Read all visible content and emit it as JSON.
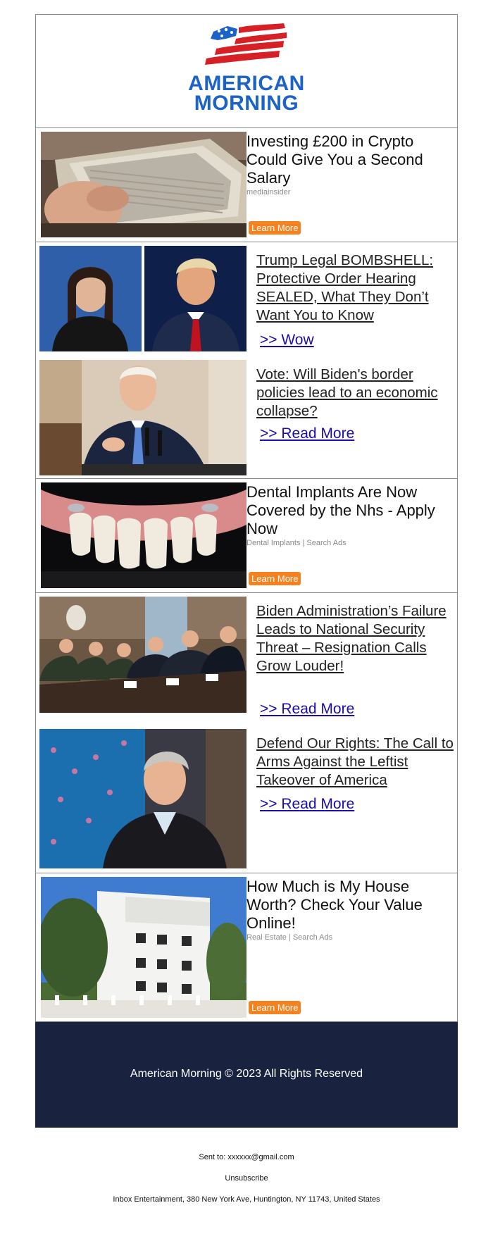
{
  "brand": {
    "name_line1": "AMERICAN",
    "name_line2": "MORNING"
  },
  "ads": [
    {
      "title": "Investing £200 in Crypto Could Give You a Second Salary",
      "source": "mediainsider",
      "cta": "Learn More",
      "image": "banknotes-in-hand-photo"
    },
    {
      "title": "Dental Implants Are Now Covered by the Nhs - Apply Now",
      "source": "Dental Implants | Search Ads",
      "cta": "Learn More",
      "image": "dental-implant-teeth-photo"
    },
    {
      "title": "How Much is My House Worth? Check Your Value Online!",
      "source": "Real Estate | Search Ads",
      "cta": "Learn More",
      "image": "white-house-building-photo"
    }
  ],
  "stories": [
    {
      "headline": "Trump Legal BOMBSHELL: Protective Order Hearing SEALED, What They Don’t Want You to Know",
      "link": ">> Wow",
      "image": "judge-and-trump-portraits"
    },
    {
      "headline": "Vote: Will Biden's border policies lead to an economic collapse?",
      "link": ">> Read More",
      "image": "biden-at-podium-photo"
    },
    {
      "headline": "Biden Administration’s Failure Leads to National Security Threat – Resignation Calls Grow Louder!",
      "link": ">> Read More",
      "image": "cabinet-meeting-photo"
    },
    {
      "headline": "Defend Our Rights: The Call to Arms Against the Leftist Takeover of America",
      "link": ">> Read More",
      "image": "man-on-tv-set-photo"
    }
  ],
  "footer": {
    "copyright": "American Morning © 2023 All Rights Reserved",
    "sent_to": "Sent to: xxxxxx@gmail.com",
    "unsubscribe": "Unsubscribe",
    "address": "Inbox Entertainment, 380 New York Ave, Huntington, NY 11743, United States"
  },
  "colors": {
    "brand_blue": "#1b63c8",
    "flag_red": "#d71f26",
    "cta_orange": "#f5821f",
    "footer_navy": "#19223f",
    "link_blue": "#1a0dab"
  }
}
